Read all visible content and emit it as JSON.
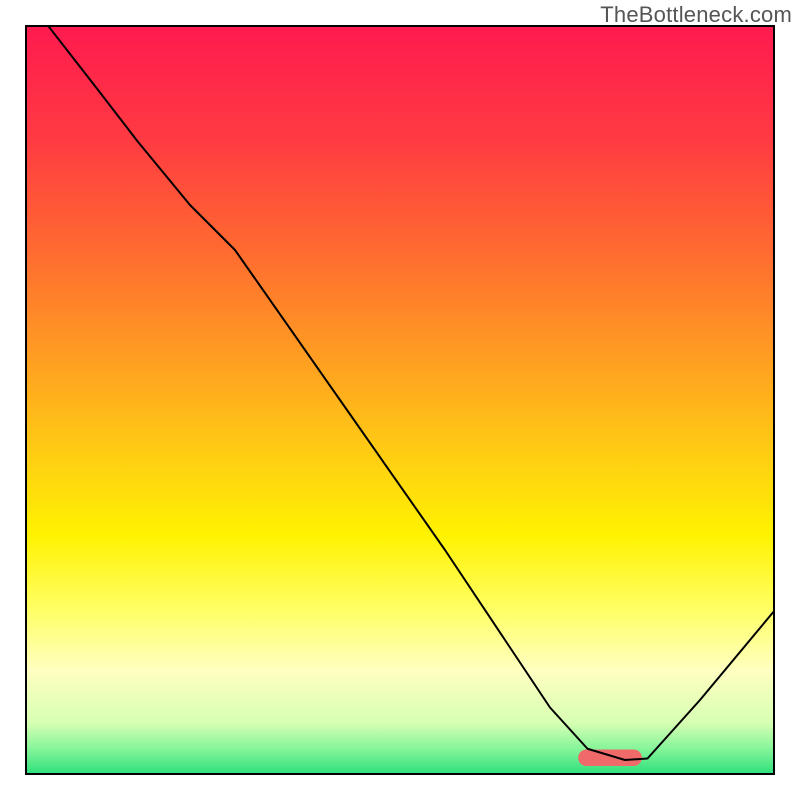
{
  "watermark": "TheBottleneck.com",
  "chart_data": {
    "type": "line",
    "title": "",
    "xlabel": "",
    "ylabel": "",
    "xlim": [
      0,
      100
    ],
    "ylim": [
      0,
      100
    ],
    "grid": false,
    "legend": false,
    "background_gradient_stops": [
      {
        "offset": 0.0,
        "color": "#ff1a4f"
      },
      {
        "offset": 0.15,
        "color": "#ff3a42"
      },
      {
        "offset": 0.3,
        "color": "#ff6a30"
      },
      {
        "offset": 0.45,
        "color": "#ffa021"
      },
      {
        "offset": 0.58,
        "color": "#ffd012"
      },
      {
        "offset": 0.68,
        "color": "#fff200"
      },
      {
        "offset": 0.78,
        "color": "#ffff66"
      },
      {
        "offset": 0.86,
        "color": "#ffffc0"
      },
      {
        "offset": 0.93,
        "color": "#d7ffb3"
      },
      {
        "offset": 0.965,
        "color": "#86f59a"
      },
      {
        "offset": 1.0,
        "color": "#2adf7a"
      }
    ],
    "series": [
      {
        "name": "bottleneck-curve",
        "x": [
          3,
          10,
          15,
          22,
          28,
          42,
          56,
          64,
          70,
          75,
          80,
          83,
          90,
          100
        ],
        "y": [
          100,
          91,
          84.5,
          76,
          70,
          50,
          30,
          18,
          9,
          3.5,
          2,
          2.2,
          10,
          22
        ]
      }
    ],
    "marker": {
      "name": "optimal-zone",
      "x_center": 78,
      "y_center": 2.3,
      "width": 8.5,
      "height": 2.2,
      "rx_pct": 1.1,
      "color": "#f06a6a"
    }
  }
}
